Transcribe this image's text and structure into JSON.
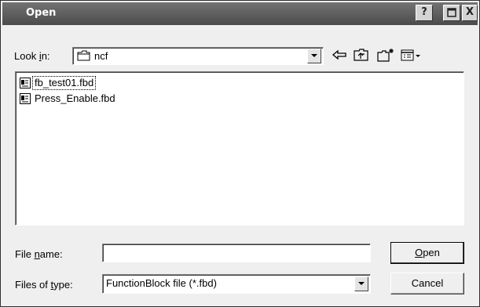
{
  "dialog": {
    "title": "Open",
    "help_button": "?",
    "close_button": "X"
  },
  "toolbar": {
    "look_in_label_pre": "Look ",
    "look_in_label_u": "i",
    "look_in_label_post": "n:",
    "look_in_value": "ncf",
    "icons": [
      "back-arrow-icon",
      "up-one-level-icon",
      "new-folder-icon",
      "view-menu-icon"
    ]
  },
  "files": [
    {
      "name": "fb_test01.fbd",
      "icon": "fbd-file-icon"
    },
    {
      "name": "Press_Enable.fbd",
      "icon": "fbd-file-icon"
    }
  ],
  "filename": {
    "label_pre": "File ",
    "label_u": "n",
    "label_post": "ame:",
    "value": ""
  },
  "filetype": {
    "label_pre": "Files of ",
    "label_u": "t",
    "label_post": "ype:",
    "value": "FunctionBlock file (*.fbd)"
  },
  "buttons": {
    "open_u": "O",
    "open_rest": "pen",
    "cancel": "Cancel"
  }
}
